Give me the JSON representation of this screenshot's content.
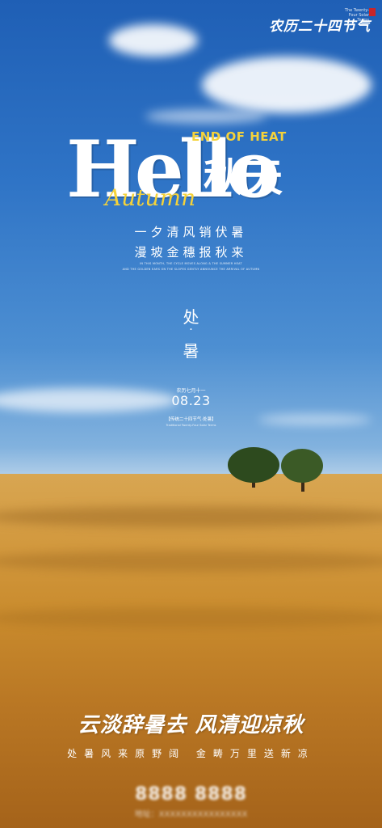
{
  "brand": {
    "logo_text": "农历二十四节气",
    "logo_sub": "The Twenty-Four Solar Terms"
  },
  "headline": {
    "hello": "Hello",
    "autumn_cn": "秋天",
    "end_of_heat": "END OF HEAT",
    "autumn_script": "Autumn"
  },
  "slogan": {
    "line1": "一夕清风销伏暑",
    "line2": "漫坡金穗报秋来"
  },
  "tiny_text": {
    "line1": "IN THIS MONTH, THE CYCLE MOVES ALONG & THE SUMMER HEAT",
    "line2": "AND THE GOLDEN EARS ON THE SLOPES GENTLY ANNOUNCE THE ARRIVAL OF AUTUMN"
  },
  "solar_term": {
    "char1": "处",
    "dot": "·",
    "char2": "暑"
  },
  "dates": {
    "lunar": "农历七月十一",
    "gregorian": "08.23",
    "tradition_cn": "【传统二十四节气·处暑】",
    "tradition_en": "Traditional Twenty-Four Solar Terms"
  },
  "poem": {
    "line1": "云淡辞暑去 风清迎凉秋",
    "line2": "处暑风来原野阔 金畴万里送新凉"
  },
  "footer_blurred": {
    "phone": "8888 8888",
    "address": "地址：XXXXXXXXXXXXXXXX"
  }
}
